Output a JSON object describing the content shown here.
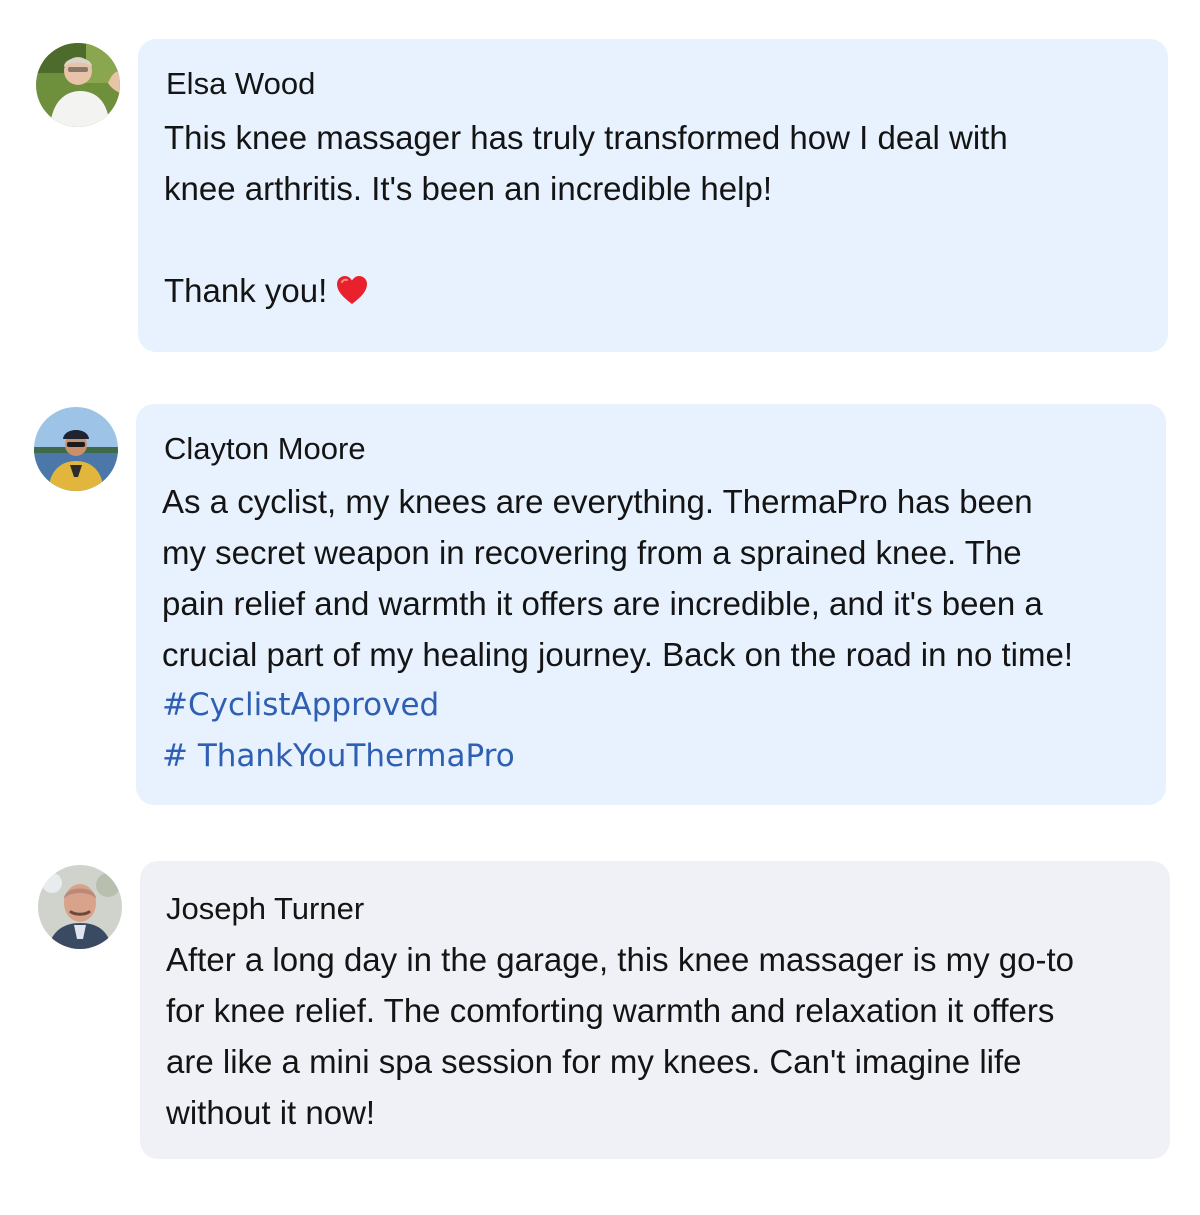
{
  "reviews": [
    {
      "name": "Elsa Wood",
      "avatar_icon": "avatar-photo-elsa",
      "bubble_color": "#e7f2fe",
      "lines": [
        "This knee massager has truly transformed how I deal with",
        "knee arthritis. It's been an incredible help!",
        "",
        "Thank you!"
      ],
      "emoji": "heart-icon"
    },
    {
      "name": "Clayton Moore",
      "avatar_icon": "avatar-photo-clayton",
      "bubble_color": "#e7f2fe",
      "lines": [
        "As a cyclist, my knees are everything. ThermaPro has been",
        "my secret weapon in recovering from a sprained knee. The",
        "pain relief and warmth it offers are incredible, and it's been a",
        "crucial part of my healing journey. Back on the road in no time!"
      ],
      "hashtags": [
        "#CyclistApproved",
        "# ThankYouThermaPro"
      ],
      "hashtag_color": "#2f5fb3"
    },
    {
      "name": "Joseph Turner",
      "avatar_icon": "avatar-photo-joseph",
      "bubble_color": "#eff1f6",
      "lines": [
        "After a long day in the garage, this knee massager is my go-to",
        "for knee relief. The comforting warmth and relaxation it offers",
        "are like a mini spa session for my knees. Can't imagine life",
        "without it now!"
      ]
    }
  ]
}
